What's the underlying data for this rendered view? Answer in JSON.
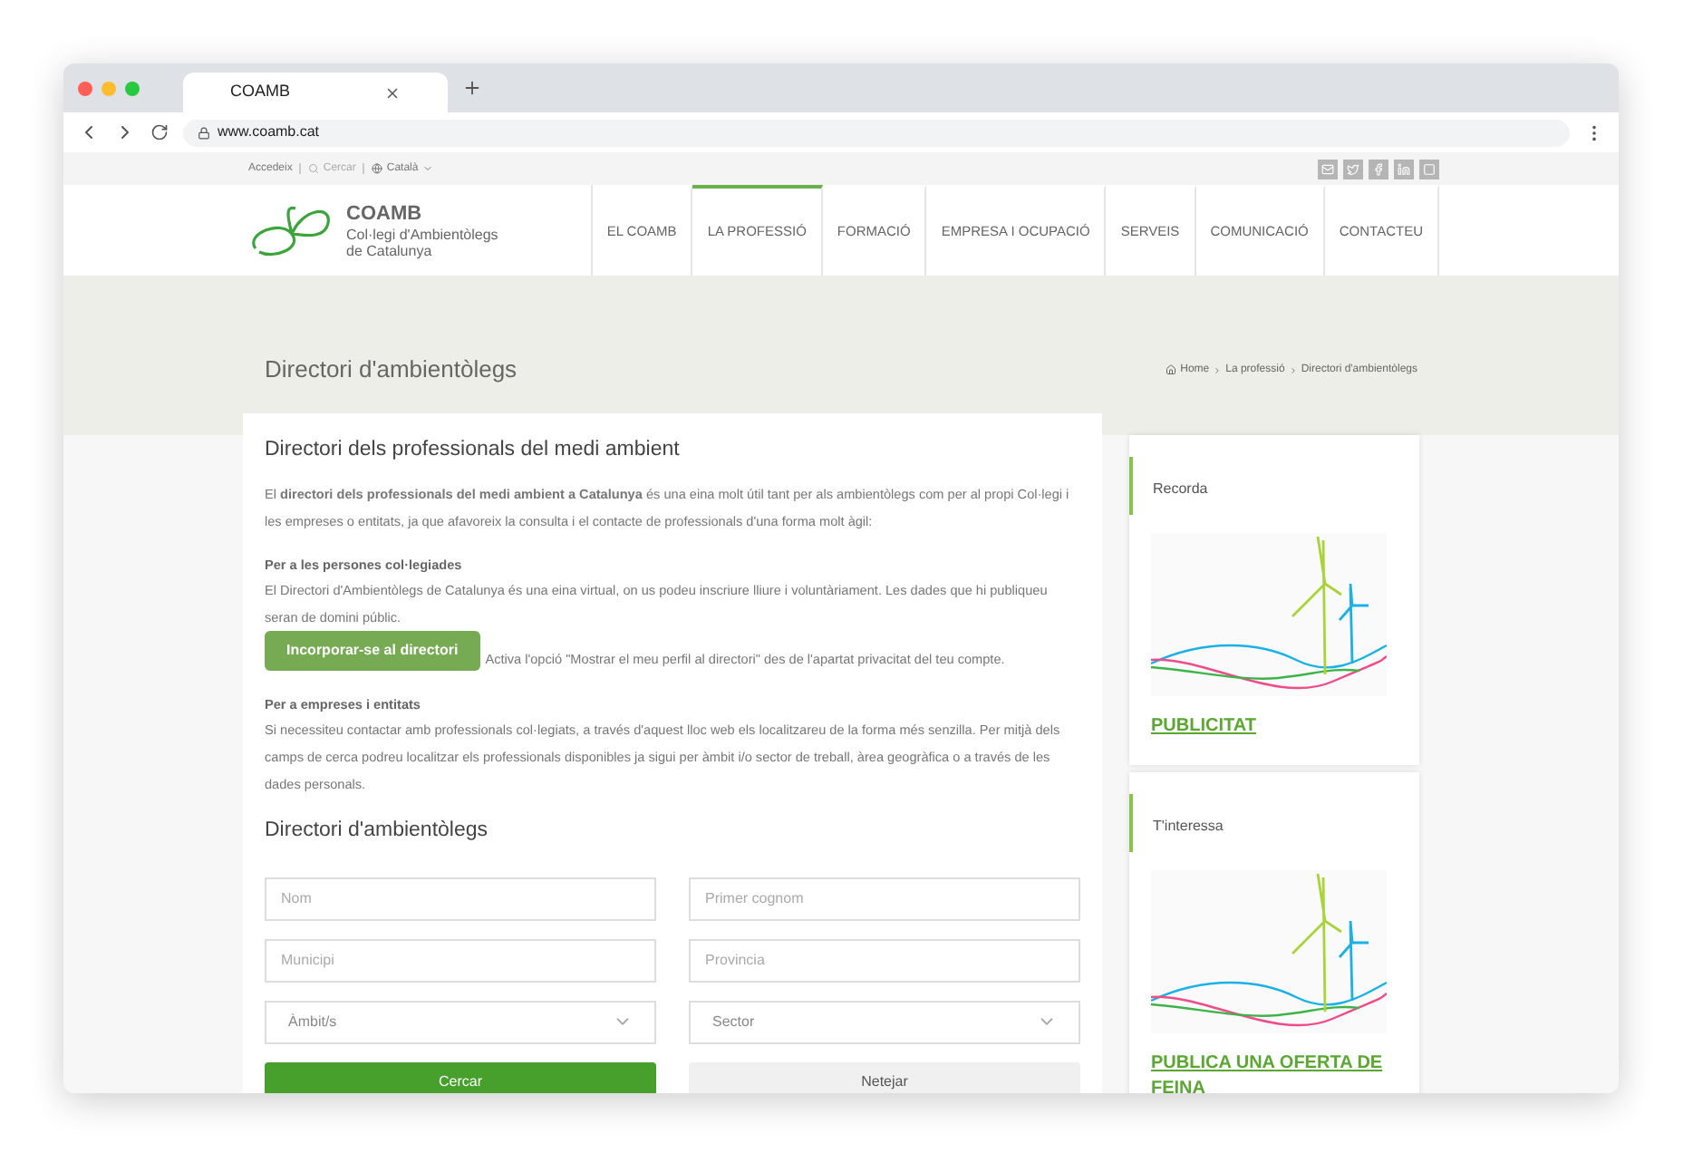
{
  "browser": {
    "tab_title": "COAMB",
    "url": "www.coamb.cat"
  },
  "top_bar": {
    "login": "Accedeix",
    "search_placeholder": "Cercar",
    "language": "Català"
  },
  "logo": {
    "name": "COAMB",
    "subtitle_line_1": "Col·legi d'Ambientòlegs",
    "subtitle_line_2": "de Catalunya"
  },
  "nav": [
    {
      "label": "EL COAMB",
      "selected": false
    },
    {
      "label": "LA PROFESSIÓ",
      "selected": true
    },
    {
      "label": "FORMACIÓ",
      "selected": false
    },
    {
      "label": "EMPRESA I OCUPACIÓ",
      "selected": false
    },
    {
      "label": "SERVEIS",
      "selected": false
    },
    {
      "label": "COMUNICACIÓ",
      "selected": false
    },
    {
      "label": "CONTACTEU",
      "selected": false
    }
  ],
  "page_title": "Directori d'ambientòlegs",
  "breadcrumb": [
    "Home",
    "La professió",
    "Directori d'ambientòlegs"
  ],
  "content": {
    "heading": "Directori dels professionals del medi ambient",
    "intro": "El **directori dels professionals del medi ambient a Catalunya** és una eina molt útil tant per als ambientòlegs com per al propi Col·legi i les empreses o entitats, ja que afavoreix la consulta i el contacte de professionals d'una forma molt àgil:",
    "section_1_title": "Per a les persones col·legiades",
    "section_1_text": "El Directori d'Ambientòlegs de Catalunya és una eina virtual, on us podeu inscriure lliure i voluntàriament. Les dades que hi publiqueu seran de domini públic.",
    "join_button": "Incorporar-se al directori",
    "join_note": "Activa l'opció \"Mostrar el meu perfil al directori\" des de l'apartat privacitat del teu compte.",
    "section_2_title": "Per a empreses i entitats",
    "section_2_text": "Si necessiteu contactar amb professionals col·legiats, a través d'aquest lloc web els localitzareu de la forma més senzilla. Per mitjà dels camps de cerca podreu localitzar els professionals disponibles ja sigui per àmbit i/o sector de treball, àrea geogràfica o a través de les dades personals."
  },
  "search_form": {
    "heading": "Directori d'ambientòlegs",
    "fields": [
      {
        "kind": "input",
        "placeholder": "Nom"
      },
      {
        "kind": "input",
        "placeholder": "Primer cognom"
      },
      {
        "kind": "input",
        "placeholder": "Municipi"
      },
      {
        "kind": "input",
        "placeholder": "Provincia"
      },
      {
        "kind": "select",
        "value": "Àmbit/s"
      },
      {
        "kind": "select",
        "value": "Sector"
      }
    ],
    "search_button": "Cercar",
    "clear_button": "Netejar"
  },
  "sidebar": [
    {
      "heading": "Recorda",
      "link": "PUBLICITAT"
    },
    {
      "heading": "T'interessa",
      "link": "PUBLICA UNA OFERTA DE FEINA"
    }
  ]
}
